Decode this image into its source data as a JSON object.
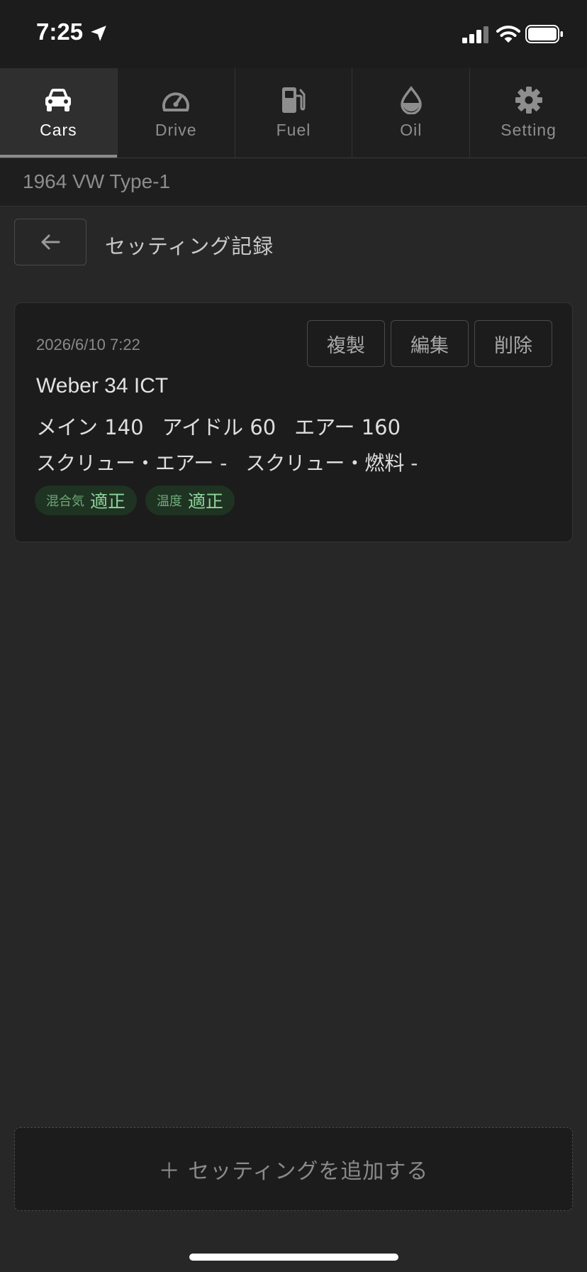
{
  "status_bar": {
    "time": "7:25"
  },
  "tabs": [
    {
      "label": "Cars",
      "icon": "car-icon",
      "active": true
    },
    {
      "label": "Drive",
      "icon": "speedometer-icon",
      "active": false
    },
    {
      "label": "Fuel",
      "icon": "fuel-pump-icon",
      "active": false
    },
    {
      "label": "Oil",
      "icon": "oil-drop-icon",
      "active": false
    },
    {
      "label": "Setting",
      "icon": "gear-icon",
      "active": false
    }
  ],
  "car": {
    "name": "1964 VW Type-1"
  },
  "page": {
    "title": "セッティング記録",
    "back_icon": "arrow-left-icon"
  },
  "record": {
    "date": "2026/6/10 7:22",
    "actions": {
      "duplicate": "複製",
      "edit": "編集",
      "delete": "削除"
    },
    "carburetor": "Weber 34 ICT",
    "jets": {
      "main": "メイン 140",
      "idle": "アイドル 60",
      "air": "エアー 160"
    },
    "screws": {
      "air": "スクリュー・エアー -",
      "fuel": "スクリュー・燃料 -"
    },
    "badges": [
      {
        "key": "混合気",
        "value": "適正"
      },
      {
        "key": "温度",
        "value": "適正"
      }
    ]
  },
  "add_button": {
    "label": "＋ セッティングを追加する"
  },
  "colors": {
    "background": "#272727",
    "card": "#1c1c1c",
    "badge_bg": "#1e3322",
    "badge_text": "#8fd39a"
  }
}
